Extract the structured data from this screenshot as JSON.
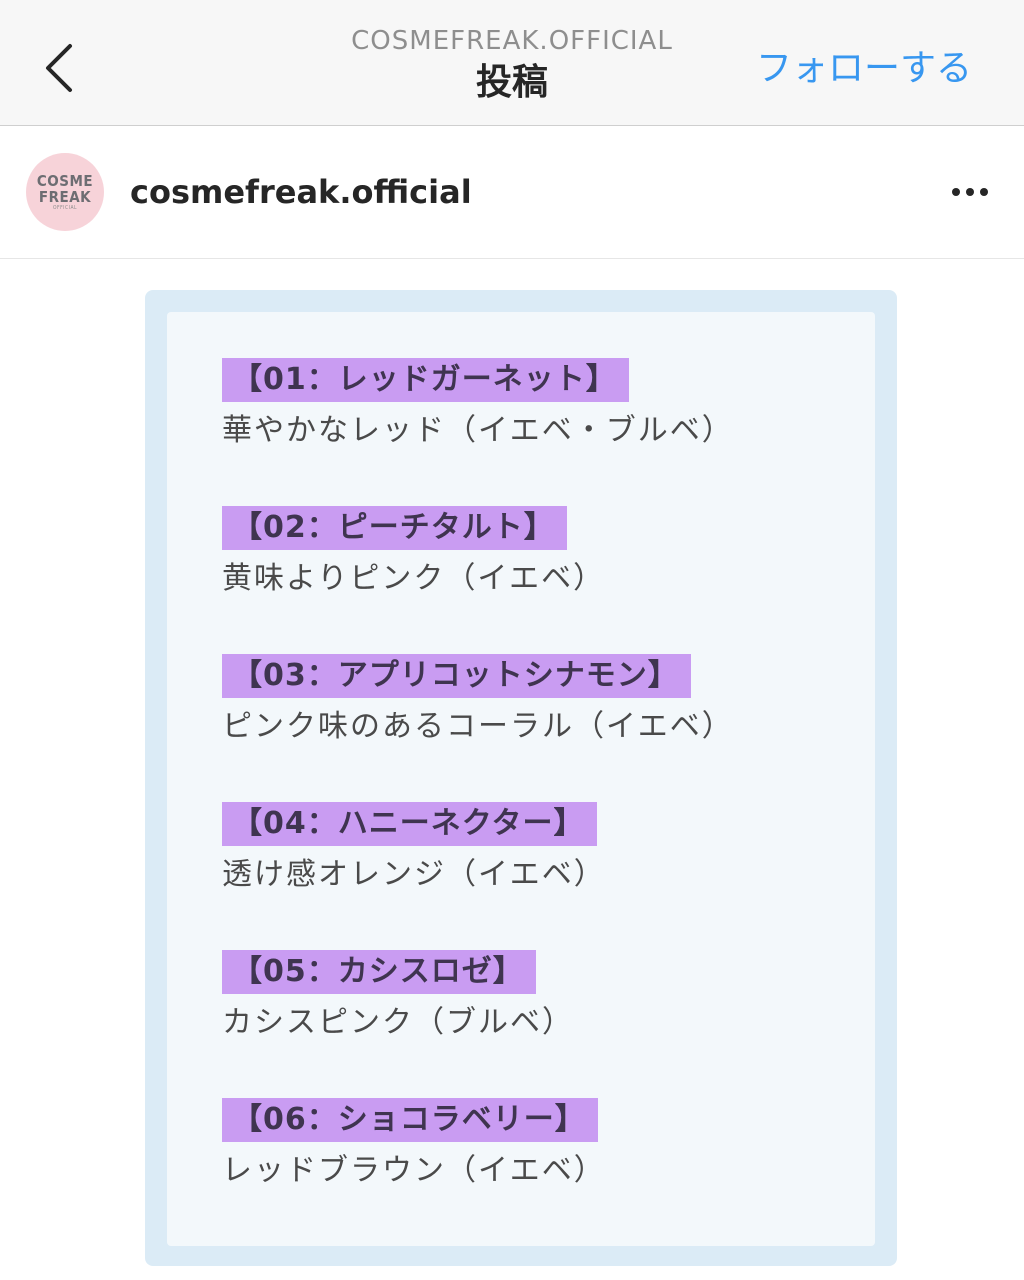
{
  "navbar": {
    "account_caption": "COSMEFREAK.OFFICIAL",
    "title": "投稿",
    "follow_label": "フォローする"
  },
  "post_header": {
    "avatar_line1": "COSME",
    "avatar_line2": "FREAK",
    "avatar_small": "OFFICIAL",
    "username": "cosmefreak.official"
  },
  "colors": {
    "accent": "#3897f0",
    "highlight": "#c99cf2",
    "card_border": "#dbebf6",
    "card_bg": "#f3f8fb",
    "avatar_bg": "#f7d3d9"
  },
  "icons": {
    "back": "chevron-left-icon",
    "more": "more-horizontal-icon"
  },
  "shades": [
    {
      "title": "【01：レッドガーネット】",
      "desc": "華やかなレッド（イエベ・ブルベ）"
    },
    {
      "title": "【02：ピーチタルト】",
      "desc": "黄味よりピンク（イエベ）"
    },
    {
      "title": "【03：アプリコットシナモン】",
      "desc": "ピンク味のあるコーラル（イエベ）"
    },
    {
      "title": "【04：ハニーネクター】",
      "desc": "透け感オレンジ（イエベ）"
    },
    {
      "title": "【05：カシスロゼ】",
      "desc": "カシスピンク（ブルベ）"
    },
    {
      "title": "【06：ショコラベリー】",
      "desc": "レッドブラウン（イエベ）"
    }
  ]
}
